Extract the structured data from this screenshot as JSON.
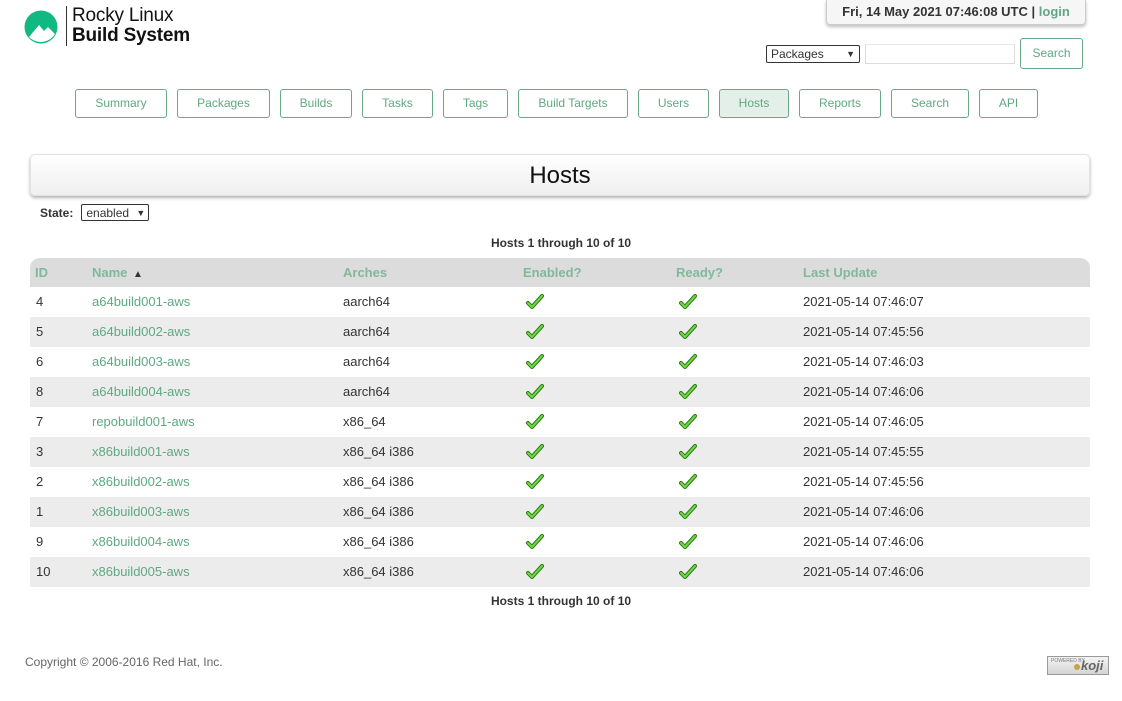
{
  "logo": {
    "line1": "Rocky Linux",
    "line2": "Build System",
    "icon": "rocky-linux-logo-icon",
    "color": "#10b981"
  },
  "header": {
    "datetime": "Fri, 14 May 2021 07:46:08 UTC",
    "separator": "|",
    "login_label": "login"
  },
  "search": {
    "type_selected": "Packages",
    "query": "",
    "button_label": "Search"
  },
  "nav": {
    "tabs": [
      {
        "label": "Summary",
        "active": false
      },
      {
        "label": "Packages",
        "active": false
      },
      {
        "label": "Builds",
        "active": false
      },
      {
        "label": "Tasks",
        "active": false
      },
      {
        "label": "Tags",
        "active": false
      },
      {
        "label": "Build Targets",
        "active": false
      },
      {
        "label": "Users",
        "active": false
      },
      {
        "label": "Hosts",
        "active": true
      },
      {
        "label": "Reports",
        "active": false
      },
      {
        "label": "Search",
        "active": false
      },
      {
        "label": "API",
        "active": false
      }
    ]
  },
  "page": {
    "title": "Hosts"
  },
  "filter": {
    "state_label": "State:",
    "state_value": "enabled"
  },
  "pager": {
    "prefix": "Hosts",
    "start": "1",
    "through": "through",
    "end": "10",
    "of": "of",
    "total": "10"
  },
  "table": {
    "headers": {
      "id": "ID",
      "name": "Name",
      "arches": "Arches",
      "enabled": "Enabled?",
      "ready": "Ready?",
      "last_update": "Last Update"
    },
    "sort_icon": "sort-ascending-icon",
    "rows": [
      {
        "id": "4",
        "name": "a64build001-aws",
        "arches": "aarch64",
        "enabled": true,
        "ready": true,
        "last_update": "2021-05-14 07:46:07"
      },
      {
        "id": "5",
        "name": "a64build002-aws",
        "arches": "aarch64",
        "enabled": true,
        "ready": true,
        "last_update": "2021-05-14 07:45:56"
      },
      {
        "id": "6",
        "name": "a64build003-aws",
        "arches": "aarch64",
        "enabled": true,
        "ready": true,
        "last_update": "2021-05-14 07:46:03"
      },
      {
        "id": "8",
        "name": "a64build004-aws",
        "arches": "aarch64",
        "enabled": true,
        "ready": true,
        "last_update": "2021-05-14 07:46:06"
      },
      {
        "id": "7",
        "name": "repobuild001-aws",
        "arches": "x86_64",
        "enabled": true,
        "ready": true,
        "last_update": "2021-05-14 07:46:05"
      },
      {
        "id": "3",
        "name": "x86build001-aws",
        "arches": "x86_64 i386",
        "enabled": true,
        "ready": true,
        "last_update": "2021-05-14 07:45:55"
      },
      {
        "id": "2",
        "name": "x86build002-aws",
        "arches": "x86_64 i386",
        "enabled": true,
        "ready": true,
        "last_update": "2021-05-14 07:45:56"
      },
      {
        "id": "1",
        "name": "x86build003-aws",
        "arches": "x86_64 i386",
        "enabled": true,
        "ready": true,
        "last_update": "2021-05-14 07:46:06"
      },
      {
        "id": "9",
        "name": "x86build004-aws",
        "arches": "x86_64 i386",
        "enabled": true,
        "ready": true,
        "last_update": "2021-05-14 07:46:06"
      },
      {
        "id": "10",
        "name": "x86build005-aws",
        "arches": "x86_64 i386",
        "enabled": true,
        "ready": true,
        "last_update": "2021-05-14 07:46:06"
      }
    ]
  },
  "footer": {
    "copyright": "Copyright © 2006-2016 Red Hat, Inc.",
    "powered_by": "POWERED BY",
    "powered_brand": "koji"
  },
  "colors": {
    "accent": "#5fa883",
    "header_text": "#7fb99a",
    "check": "#3cb81c"
  }
}
